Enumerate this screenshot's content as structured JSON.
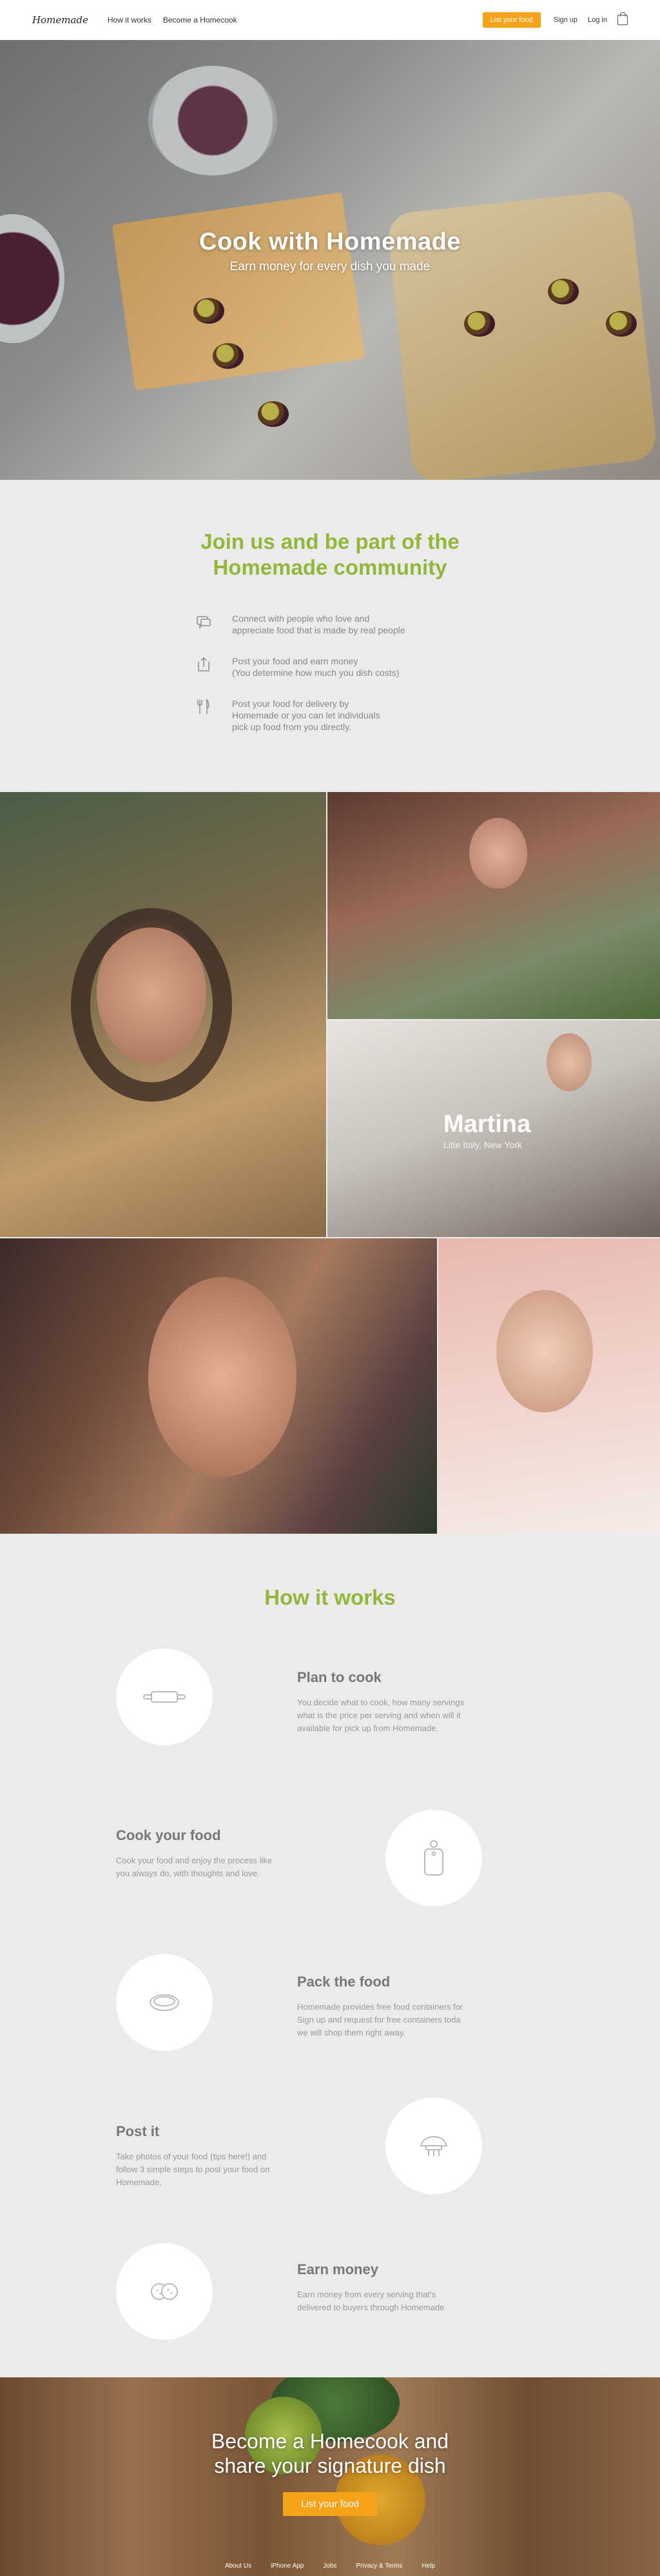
{
  "header": {
    "logo": "Homemade",
    "nav": [
      "How it works",
      "Become a Homecook"
    ],
    "list_button": "List your food",
    "sign_up": "Sign up",
    "log_in": "Log in",
    "cart_icon": "bag-icon"
  },
  "hero": {
    "title": "Cook with Homemade",
    "subtitle": "Earn money for every dish you made"
  },
  "join": {
    "title_line1": "Join us and be part of the",
    "title_line2": "Homemade community",
    "features": [
      {
        "icon": "chat-icon",
        "lines": [
          "Connect with people who love and",
          "appreciate food that is made by real people"
        ]
      },
      {
        "icon": "upload-icon",
        "lines": [
          "Post your food and earn money",
          "(You determine how much you dish costs)"
        ]
      },
      {
        "icon": "fork-knife-icon",
        "lines": [
          "Post your food for delivery by",
          "Homemade or you can let individuals",
          "pick up food from you directly."
        ]
      }
    ]
  },
  "cooks": {
    "featured_name": "Martina",
    "featured_location": "Litte Italy, New York"
  },
  "how": {
    "title": "How it works",
    "steps": [
      {
        "title": "Plan to cook",
        "icon": "rolling-pin-icon",
        "lines": [
          "You decide what to cook, how many servings",
          "what is the price per serving and when will it",
          "available for pick up from Homemade."
        ]
      },
      {
        "title": "Cook your food",
        "icon": "cutting-board-icon",
        "lines": [
          "Cook your food and enjoy the process like",
          "you always do, with thoughts and love."
        ]
      },
      {
        "title": "Pack the food",
        "icon": "container-icon",
        "lines": [
          "Homemade provides free food containers for",
          "Sign up and request for free containers toda",
          "we will shop them right away."
        ]
      },
      {
        "title": "Post it",
        "icon": "camera-icon",
        "lines": [
          "Take photos of your food (tips here!) and",
          "follow 3 simple steps to post your food on",
          "Homemade."
        ]
      },
      {
        "title": "Earn money",
        "icon": "coins-icon",
        "lines": [
          "Earn money from every serving that's",
          "delivered to buyers through Homemade"
        ]
      }
    ]
  },
  "cta": {
    "title_line1": "Become a Homecook and",
    "title_line2": "share your signature dish",
    "button": "List your food"
  },
  "footer": {
    "links": [
      "About Us",
      "iPhone App",
      "Jobs",
      "Privacy & Terms",
      "Help"
    ]
  },
  "colors": {
    "accent_green": "#92b73b",
    "button_orange": "#f6a31b",
    "background": "#ecebeb"
  }
}
